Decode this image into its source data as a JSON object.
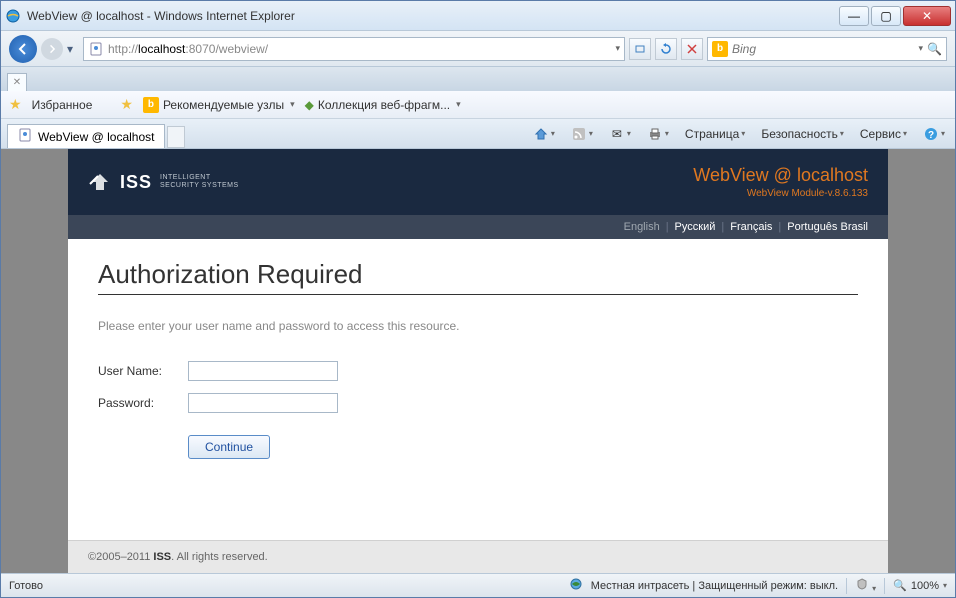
{
  "window": {
    "title": "WebView @ localhost - Windows Internet Explorer"
  },
  "address": {
    "protocol": "http://",
    "host": "localhost",
    "port": ":8070",
    "path": "/webview/"
  },
  "search": {
    "engine": "Bing",
    "placeholder": "Bing"
  },
  "favorites": {
    "label": "Избранное",
    "suggested": "Рекомендуемые узлы",
    "fragments": "Коллекция веб-фрагм..."
  },
  "tab": {
    "title": "WebView @ localhost"
  },
  "commands": {
    "page": "Страница",
    "safety": "Безопасность",
    "tools": "Сервис"
  },
  "page": {
    "logo_text": "ISS",
    "logo_sub1": "INTELLIGENT",
    "logo_sub2": "SECURITY SYSTEMS",
    "header_title": "WebView @ localhost",
    "header_sub": "WebView Module-v.8.6.133",
    "langs": {
      "en": "English",
      "ru": "Русский",
      "fr": "Français",
      "pt": "Português Brasil"
    },
    "heading": "Authorization Required",
    "instruction": "Please enter your user name and password to access this resource.",
    "username_label": "User Name:",
    "password_label": "Password:",
    "continue": "Continue",
    "footer_years": "©2005–2011 ",
    "footer_company": "ISS",
    "footer_rights": ". All rights reserved."
  },
  "status": {
    "ready": "Готово",
    "zone": "Местная интрасеть | Защищенный режим: выкл.",
    "zoom": "100%"
  }
}
